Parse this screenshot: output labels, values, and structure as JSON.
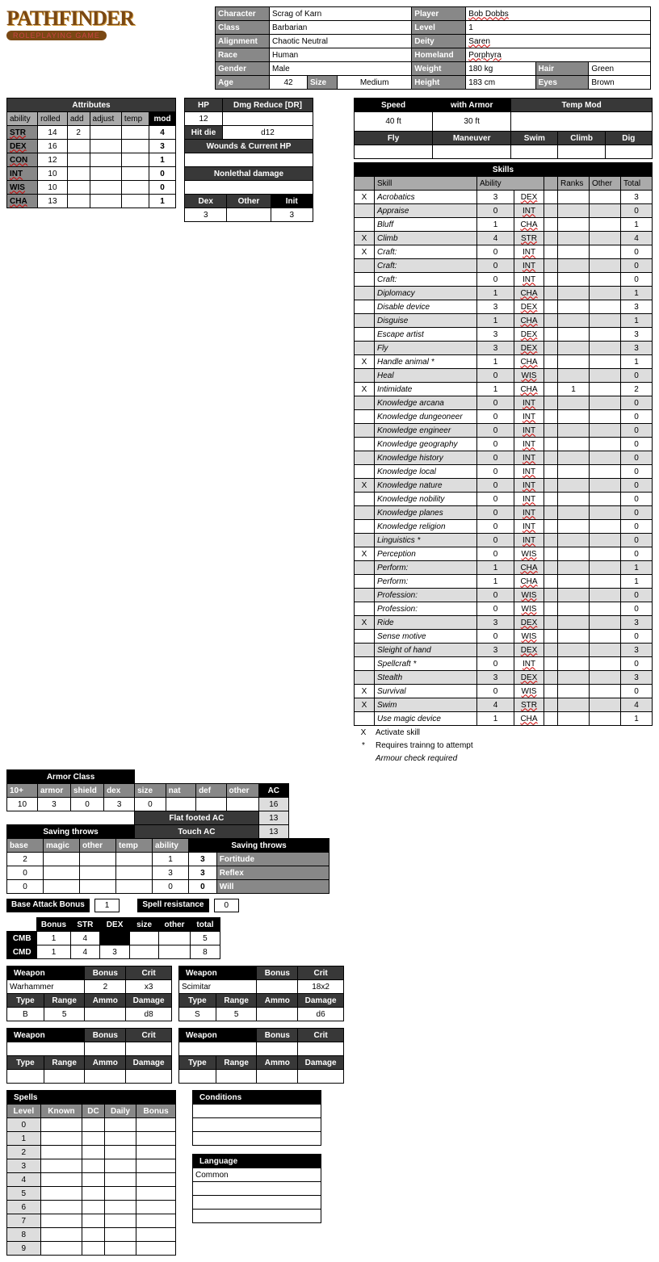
{
  "logo": {
    "title": "PATHFINDER",
    "sub": "ROLEPLAYING GAME"
  },
  "ci": {
    "r1": [
      [
        "Character",
        "Scrag of Karn"
      ],
      [
        "Player",
        "Bob Dobbs"
      ]
    ],
    "r2": [
      [
        "Class",
        "Barbarian"
      ],
      [
        "Level",
        "1"
      ]
    ],
    "r3": [
      [
        "Alignment",
        "Chaotic Neutral"
      ],
      [
        "Deity",
        "Saren"
      ]
    ],
    "r4": [
      [
        "Race",
        "Human"
      ],
      [
        "Homeland",
        "Porphyra"
      ]
    ],
    "r5": [
      [
        "Gender",
        "Male"
      ],
      [
        "Weight",
        "180 kg"
      ],
      [
        "Hair",
        "Green"
      ]
    ],
    "r6": [
      [
        "Age",
        "42"
      ],
      [
        "Size",
        "Medium"
      ],
      [
        "Height",
        "183 cm"
      ],
      [
        "Eyes",
        "Brown"
      ]
    ]
  },
  "attr": {
    "title": "Attributes",
    "cols": [
      "ability",
      "rolled",
      "add",
      "adjust",
      "temp",
      "mod"
    ],
    "rows": [
      [
        "STR",
        "14",
        "2",
        "",
        "",
        "4"
      ],
      [
        "DEX",
        "16",
        "",
        "",
        "",
        "3"
      ],
      [
        "CON",
        "12",
        "",
        "",
        "",
        "1"
      ],
      [
        "INT",
        "10",
        "",
        "",
        "",
        "0"
      ],
      [
        "WIS",
        "10",
        "",
        "",
        "",
        "0"
      ],
      [
        "CHA",
        "13",
        "",
        "",
        "",
        "1"
      ]
    ]
  },
  "hp": {
    "cols": [
      "HP",
      "Dmg Reduce [DR]"
    ],
    "vals": [
      "12",
      ""
    ],
    "hitdie_lbl": "Hit die",
    "hitdie": "d12",
    "wc": "Wounds & Current HP",
    "nl": "Nonlethal damage",
    "ini_cols": [
      "Dex",
      "Other",
      "Init"
    ],
    "ini_vals": [
      "3",
      "",
      "3"
    ]
  },
  "speed": {
    "cols": [
      "Speed",
      "with Armor",
      "Temp Mod"
    ],
    "vals": [
      "40 ft",
      "30 ft",
      ""
    ],
    "cols2": [
      "Fly",
      "Maneuver",
      "Swim",
      "Climb",
      "Dig"
    ]
  },
  "ac": {
    "title": "Armor Class",
    "cols": [
      "10+",
      "armor",
      "shield",
      "dex",
      "size",
      "nat",
      "def",
      "other",
      "AC"
    ],
    "vals": [
      "10",
      "3",
      "0",
      "3",
      "0",
      "",
      "",
      "",
      "16"
    ],
    "ff": "Flat footed AC",
    "ffv": "13",
    "touch": "Touch AC",
    "touchv": "13"
  },
  "saves": {
    "title": "Saving throws",
    "cols": [
      "base",
      "magic",
      "other",
      "temp",
      "ability",
      "Saving throws"
    ],
    "rows": [
      [
        "2",
        "",
        "",
        "",
        "1",
        "3",
        "Fortitude"
      ],
      [
        "0",
        "",
        "",
        "",
        "3",
        "3",
        "Reflex"
      ],
      [
        "0",
        "",
        "",
        "",
        "0",
        "0",
        "Will"
      ]
    ]
  },
  "bab": {
    "lbl": "Base Attack Bonus",
    "val": "1",
    "sr_lbl": "Spell resistance",
    "sr_val": "0"
  },
  "cmb": {
    "cols": [
      "",
      "Bonus",
      "STR",
      "DEX",
      "size",
      "other",
      "total"
    ],
    "rows": [
      [
        "CMB",
        "1",
        "4",
        "",
        "",
        "",
        "5"
      ],
      [
        "CMD",
        "1",
        "4",
        "3",
        "",
        "",
        "8"
      ]
    ]
  },
  "weapons": [
    {
      "name": "Warhammer",
      "bonus": "2",
      "crit": "x3",
      "type": "B",
      "range": "5",
      "ammo": "",
      "dmg": "d8"
    },
    {
      "name": "Scimitar",
      "bonus": "",
      "crit": "18x2",
      "type": "S",
      "range": "5",
      "ammo": "",
      "dmg": "d6"
    },
    {
      "name": "",
      "bonus": "",
      "crit": "",
      "type": "",
      "range": "",
      "ammo": "",
      "dmg": ""
    },
    {
      "name": "",
      "bonus": "",
      "crit": "",
      "type": "",
      "range": "",
      "ammo": "",
      "dmg": ""
    }
  ],
  "wlabels": {
    "w": "Weapon",
    "b": "Bonus",
    "c": "Crit",
    "t": "Type",
    "r": "Range",
    "a": "Ammo",
    "d": "Damage"
  },
  "spells": {
    "title": "Spells",
    "cols": [
      "Level",
      "Known",
      "DC",
      "Daily",
      "Bonus"
    ],
    "levels": [
      "0",
      "1",
      "2",
      "3",
      "4",
      "5",
      "6",
      "7",
      "8",
      "9"
    ]
  },
  "cond": {
    "title": "Conditions"
  },
  "lang": {
    "title": "Language",
    "val": "Common"
  },
  "skills": {
    "title": "Skills",
    "cols": [
      "",
      "Skill",
      "",
      "Ability",
      "",
      "Ranks",
      "Other",
      "Total"
    ],
    "rows": [
      [
        "X",
        "Acrobatics",
        "3",
        "DEX",
        "",
        "",
        "3"
      ],
      [
        "",
        "Appraise",
        "0",
        "INT",
        "",
        "",
        "0"
      ],
      [
        "",
        "Bluff",
        "1",
        "CHA",
        "",
        "",
        "1"
      ],
      [
        "X",
        "Climb",
        "4",
        "STR",
        "",
        "",
        "4"
      ],
      [
        "X",
        "Craft:",
        "0",
        "INT",
        "",
        "",
        "0"
      ],
      [
        "",
        "Craft:",
        "0",
        "INT",
        "",
        "",
        "0"
      ],
      [
        "",
        "Craft:",
        "0",
        "INT",
        "",
        "",
        "0"
      ],
      [
        "",
        "Diplomacy",
        "1",
        "CHA",
        "",
        "",
        "1"
      ],
      [
        "",
        "Disable device",
        "3",
        "DEX",
        "",
        "",
        "3"
      ],
      [
        "",
        "Disguise",
        "1",
        "CHA",
        "",
        "",
        "1"
      ],
      [
        "",
        "Escape artist",
        "3",
        "DEX",
        "",
        "",
        "3"
      ],
      [
        "",
        "Fly",
        "3",
        "DEX",
        "",
        "",
        "3"
      ],
      [
        "X",
        "Handle animal *",
        "1",
        "CHA",
        "",
        "",
        "1"
      ],
      [
        "",
        "Heal",
        "0",
        "WIS",
        "",
        "",
        "0"
      ],
      [
        "X",
        "Intimidate",
        "1",
        "CHA",
        "1",
        "",
        "2"
      ],
      [
        "",
        "Knowledge arcana",
        "0",
        "INT",
        "",
        "",
        "0"
      ],
      [
        "",
        "Knowledge dungeoneer",
        "0",
        "INT",
        "",
        "",
        "0"
      ],
      [
        "",
        "Knowledge engineer",
        "0",
        "INT",
        "",
        "",
        "0"
      ],
      [
        "",
        "Knowledge geography",
        "0",
        "INT",
        "",
        "",
        "0"
      ],
      [
        "",
        "Knowledge history",
        "0",
        "INT",
        "",
        "",
        "0"
      ],
      [
        "",
        "Knowledge local",
        "0",
        "INT",
        "",
        "",
        "0"
      ],
      [
        "X",
        "Knowledge nature",
        "0",
        "INT",
        "",
        "",
        "0"
      ],
      [
        "",
        "Knowledge nobility",
        "0",
        "INT",
        "",
        "",
        "0"
      ],
      [
        "",
        "Knowledge planes",
        "0",
        "INT",
        "",
        "",
        "0"
      ],
      [
        "",
        "Knowledge religion",
        "0",
        "INT",
        "",
        "",
        "0"
      ],
      [
        "",
        "Linguistics *",
        "0",
        "INT",
        "",
        "",
        "0"
      ],
      [
        "X",
        "Perception",
        "0",
        "WIS",
        "",
        "",
        "0"
      ],
      [
        "",
        "Perform:",
        "1",
        "CHA",
        "",
        "",
        "1"
      ],
      [
        "",
        "Perform:",
        "1",
        "CHA",
        "",
        "",
        "1"
      ],
      [
        "",
        "Profession:",
        "0",
        "WIS",
        "",
        "",
        "0"
      ],
      [
        "",
        "Profession:",
        "0",
        "WIS",
        "",
        "",
        "0"
      ],
      [
        "X",
        "Ride",
        "3",
        "DEX",
        "",
        "",
        "3"
      ],
      [
        "",
        "Sense motive",
        "0",
        "WIS",
        "",
        "",
        "0"
      ],
      [
        "",
        "Sleight of hand",
        "3",
        "DEX",
        "",
        "",
        "3"
      ],
      [
        "",
        "Spellcraft *",
        "0",
        "INT",
        "",
        "",
        "0"
      ],
      [
        "",
        "Stealth",
        "3",
        "DEX",
        "",
        "",
        "3"
      ],
      [
        "X",
        "Survival",
        "0",
        "WIS",
        "",
        "",
        "0"
      ],
      [
        "X",
        "Swim",
        "4",
        "STR",
        "",
        "",
        "4"
      ],
      [
        "",
        "Use magic device",
        "1",
        "CHA",
        "",
        "",
        "1"
      ]
    ],
    "notes": [
      [
        "X",
        "Activate skill"
      ],
      [
        "*",
        "Requires trainng to attempt"
      ],
      [
        "",
        "Armour check required"
      ]
    ]
  }
}
